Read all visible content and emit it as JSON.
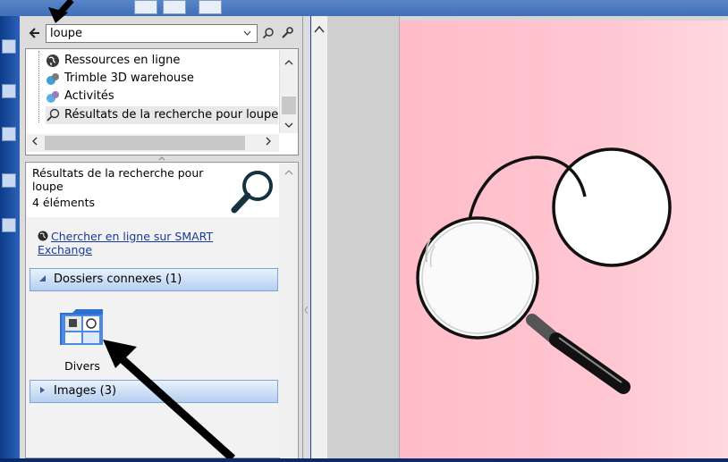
{
  "search": {
    "back_icon": "arrow-left-icon",
    "value": "loupe",
    "dropdown_icon": "chevron-down-icon",
    "go_icon": "search-icon",
    "tools_icon": "wrench-icon"
  },
  "tree": {
    "items": [
      {
        "label": "Ressources en ligne",
        "icon": "globe-icon"
      },
      {
        "label": "Trimble 3D warehouse",
        "icon": "trimble-icon"
      },
      {
        "label": "Activités",
        "icon": "activities-icon"
      },
      {
        "label": "Résultats de la recherche pour loupe",
        "icon": "search-icon"
      }
    ]
  },
  "results": {
    "title": "Résultats de la recherche pour loupe",
    "count": "4 éléments",
    "online_link": "Chercher en ligne sur SMART Exchange",
    "groups": {
      "dossiers": "Dossiers connexes (1)",
      "images": "Images (3)"
    },
    "folder_label": "Divers"
  },
  "colors": {
    "page_background": "#ffc6d1",
    "group_bar": "#cfe0f6",
    "link": "#1a3a9a",
    "app_frame": "#0b2a6b"
  }
}
